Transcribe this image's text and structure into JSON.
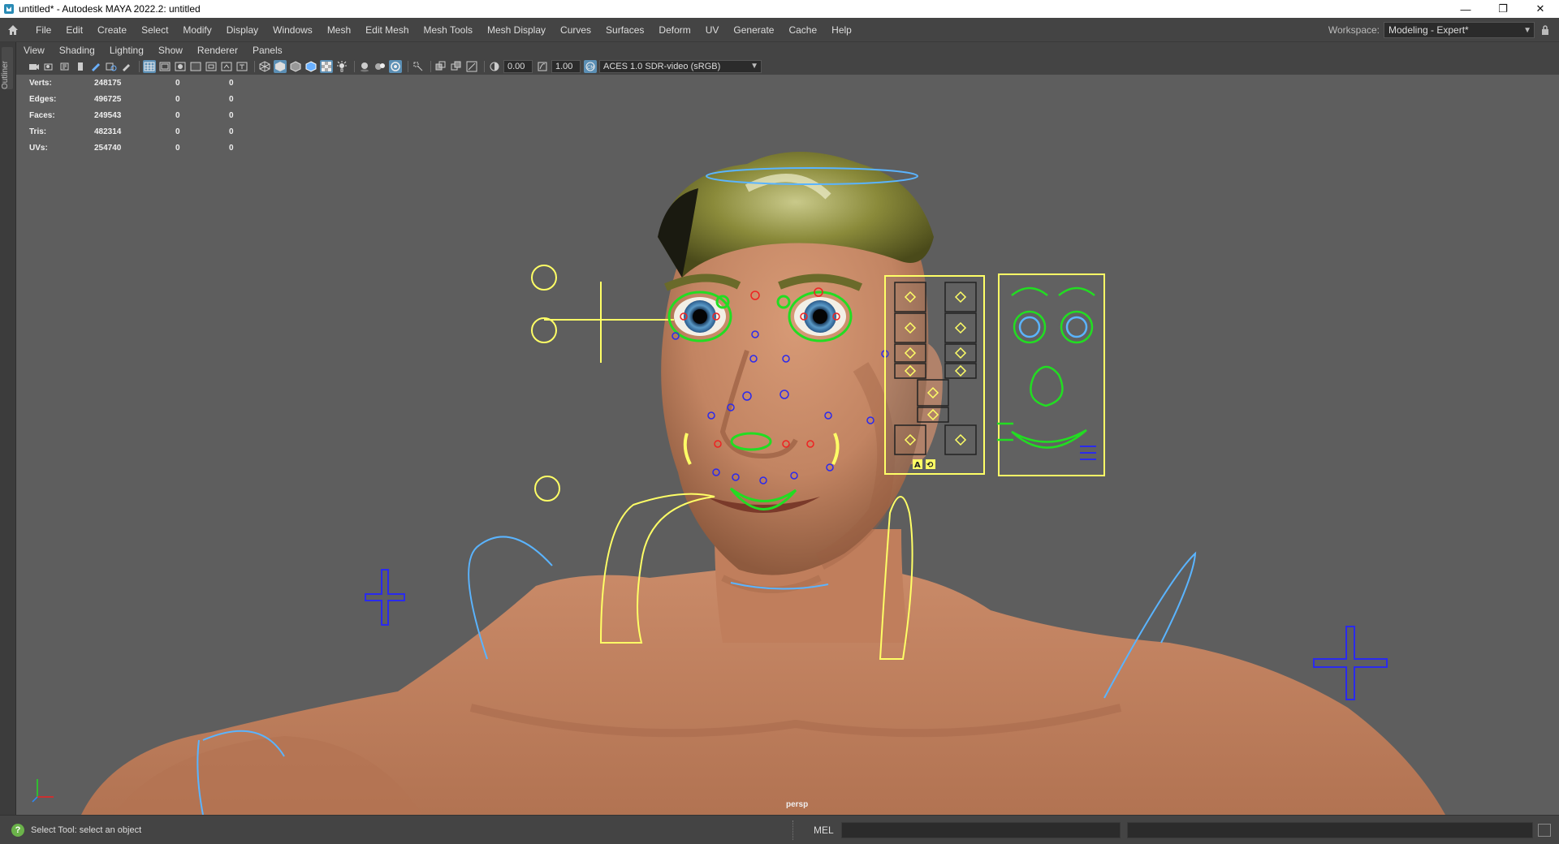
{
  "window": {
    "title": "untitled* - Autodesk MAYA 2022.2: untitled",
    "controls": [
      "—",
      "❐",
      "✕"
    ]
  },
  "menubar": {
    "items": [
      "File",
      "Edit",
      "Create",
      "Select",
      "Modify",
      "Display",
      "Windows",
      "Mesh",
      "Edit Mesh",
      "Mesh Tools",
      "Mesh Display",
      "Curves",
      "Surfaces",
      "Deform",
      "UV",
      "Generate",
      "Cache",
      "Help"
    ],
    "workspace_label": "Workspace:",
    "workspace_value": "Modeling - Expert*"
  },
  "outliner": {
    "label": "Outliner"
  },
  "panel_menu": {
    "items": [
      "View",
      "Shading",
      "Lighting",
      "Show",
      "Renderer",
      "Panels"
    ]
  },
  "panel_toolbar": {
    "exposure": "0.00",
    "gamma": "1.00",
    "colorspace": "ACES 1.0 SDR-video (sRGB)"
  },
  "hud": {
    "rows": [
      {
        "label": "Verts:",
        "value": "248175",
        "sel": "0",
        "comp": "0"
      },
      {
        "label": "Edges:",
        "value": "496725",
        "sel": "0",
        "comp": "0"
      },
      {
        "label": "Faces:",
        "value": "249543",
        "sel": "0",
        "comp": "0"
      },
      {
        "label": "Tris:",
        "value": "482314",
        "sel": "0",
        "comp": "0"
      },
      {
        "label": "UVs:",
        "value": "254740",
        "sel": "0",
        "comp": "0"
      }
    ]
  },
  "viewport": {
    "camera": "persp",
    "colors": {
      "background": "#5e5e5e",
      "skin": "#c98a68",
      "hair": "#8a8a2a",
      "ctrl_yellow": "#ffff66",
      "ctrl_green": "#22dd22",
      "ctrl_blue": "#5ab4ff",
      "ctrl_red": "#ee2222",
      "ctrl_darkblue": "#2a2aee"
    },
    "picker_buttons": [
      "A",
      "⟲"
    ]
  },
  "statusbar": {
    "help_text": "Select Tool: select an object",
    "mel_label": "MEL"
  }
}
